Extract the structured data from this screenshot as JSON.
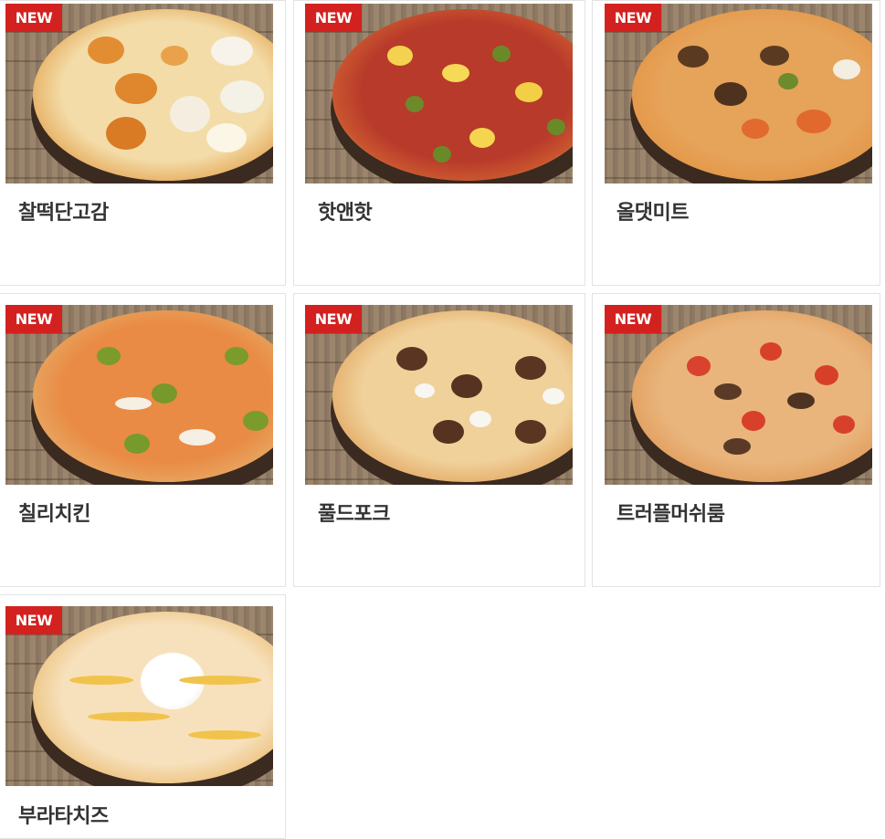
{
  "badge_label": "NEW",
  "menu": [
    {
      "name": "찰떡단고감"
    },
    {
      "name": "핫앤핫"
    },
    {
      "name": "올댓미트"
    },
    {
      "name": "칠리치킨"
    },
    {
      "name": "풀드포크"
    },
    {
      "name": "트러플머쉬룸"
    },
    {
      "name": "부라타치즈"
    }
  ]
}
